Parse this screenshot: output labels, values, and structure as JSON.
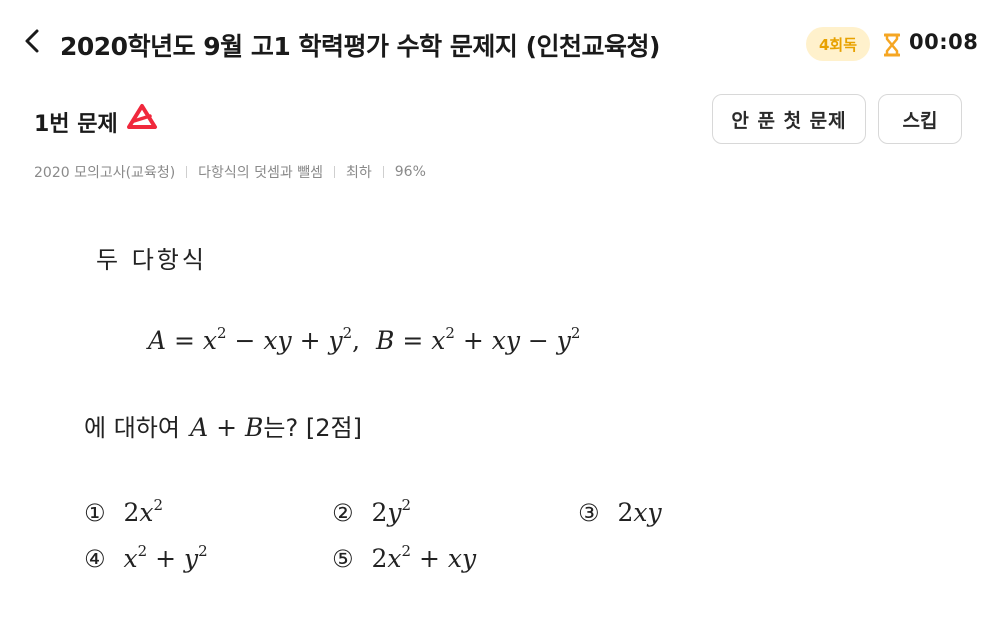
{
  "header": {
    "title": "2020학년도 9월 고1 학력평가 수학 문제지 (인천교육청)",
    "round_badge": "4회독",
    "timer": "00:08",
    "accent_color": "#f5a623"
  },
  "problem": {
    "title": "1번 문제",
    "unsolved_first_button": "안 푼 첫 문제",
    "skip_button": "스킵",
    "meta": {
      "source": "2020 모의고사(교육청)",
      "topic": "다항식의 덧셈과 뺄셈",
      "difficulty": "최하",
      "accuracy": "96%"
    },
    "text_intro": "두 다항식",
    "text_question_prefix": "에 대하여",
    "text_question_suffix": "는? [2점]",
    "choice_numbers": [
      "①",
      "②",
      "③",
      "④",
      "⑤"
    ]
  }
}
